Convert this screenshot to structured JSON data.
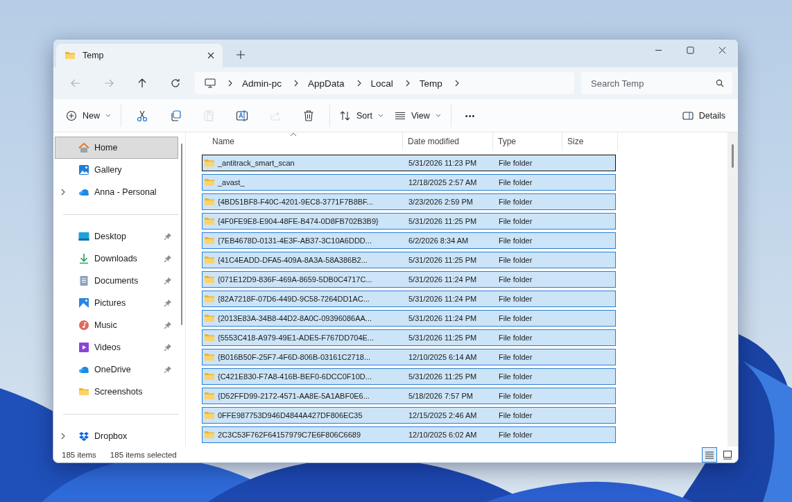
{
  "window": {
    "tabs": [
      {
        "title": "Temp",
        "selected": true
      }
    ]
  },
  "navigation": {
    "back": {
      "disabled": true
    },
    "forward": {
      "disabled": true
    },
    "up": {
      "disabled": false
    },
    "refresh": {
      "disabled": false
    }
  },
  "address_bar": {
    "segments": [
      "Admin-pc",
      "AppData",
      "Local",
      "Temp"
    ]
  },
  "search": {
    "placeholder": "Search Temp"
  },
  "toolbar": {
    "new": {
      "label": "New"
    },
    "actions": [
      {
        "disabled": false
      },
      {
        "disabled": false
      },
      {
        "disabled": true
      },
      {
        "disabled": false
      },
      {
        "disabled": true
      },
      {
        "disabled": false
      }
    ],
    "sort": {
      "label": "Sort"
    },
    "view": {
      "label": "View"
    },
    "more": {
      "label": "•••"
    },
    "details": {
      "label": "Details"
    }
  },
  "sidebar": {
    "sections": [
      {
        "items": [
          {
            "label": "Home",
            "selected": true,
            "expandable": false,
            "pinned": false
          },
          {
            "label": "Gallery",
            "selected": false,
            "expandable": false,
            "pinned": false
          },
          {
            "label": "Anna - Personal",
            "selected": false,
            "expandable": true,
            "pinned": false
          }
        ]
      },
      {
        "items": [
          {
            "label": "Desktop",
            "selected": false,
            "expandable": false,
            "pinned": true
          },
          {
            "label": "Downloads",
            "selected": false,
            "expandable": false,
            "pinned": true
          },
          {
            "label": "Documents",
            "selected": false,
            "expandable": false,
            "pinned": true
          },
          {
            "label": "Pictures",
            "selected": false,
            "expandable": false,
            "pinned": true
          },
          {
            "label": "Music",
            "selected": false,
            "expandable": false,
            "pinned": true
          },
          {
            "label": "Videos",
            "selected": false,
            "expandable": false,
            "pinned": true
          },
          {
            "label": "OneDrive",
            "selected": false,
            "expandable": false,
            "pinned": true
          },
          {
            "label": "Screenshots",
            "selected": false,
            "expandable": false,
            "pinned": false
          }
        ]
      },
      {
        "items": [
          {
            "label": "Dropbox",
            "selected": false,
            "expandable": true,
            "pinned": false
          }
        ]
      }
    ]
  },
  "table": {
    "columns": [
      "Name",
      "Date modified",
      "Type",
      "Size"
    ],
    "rows": [
      {
        "name": "_antitrack_smart_scan",
        "date": "5/31/2026 11:23 PM",
        "type": "File folder",
        "selected": true,
        "focused": true
      },
      {
        "name": "_avast_",
        "date": "12/18/2025 2:57 AM",
        "type": "File folder",
        "selected": true,
        "focused": false
      },
      {
        "name": "{4BD51BF8-F40C-4201-9EC8-3771F7B8BF...",
        "date": "3/23/2026 2:59 PM",
        "type": "File folder",
        "selected": true,
        "focused": false
      },
      {
        "name": "{4F0FE9E8-E904-48FE-B474-0D8FB702B3B9}",
        "date": "5/31/2026 11:25 PM",
        "type": "File folder",
        "selected": true,
        "focused": false
      },
      {
        "name": "{7EB4678D-0131-4E3F-AB37-3C10A6DDD...",
        "date": "6/2/2026 8:34 AM",
        "type": "File folder",
        "selected": true,
        "focused": false
      },
      {
        "name": "{41C4EADD-DFA5-409A-8A3A-58A386B2...",
        "date": "5/31/2026 11:25 PM",
        "type": "File folder",
        "selected": true,
        "focused": false
      },
      {
        "name": "{071E12D9-836F-469A-8659-5DB0C4717C...",
        "date": "5/31/2026 11:24 PM",
        "type": "File folder",
        "selected": true,
        "focused": false
      },
      {
        "name": "{82A7218F-07D6-449D-9C58-7264DD1AC...",
        "date": "5/31/2026 11:24 PM",
        "type": "File folder",
        "selected": true,
        "focused": false
      },
      {
        "name": "{2013E83A-34B8-44D2-8A0C-09396086AA...",
        "date": "5/31/2026 11:24 PM",
        "type": "File folder",
        "selected": true,
        "focused": false
      },
      {
        "name": "{5553C418-A979-49E1-ADE5-F767DD704E...",
        "date": "5/31/2026 11:25 PM",
        "type": "File folder",
        "selected": true,
        "focused": false
      },
      {
        "name": "{B016B50F-25F7-4F6D-806B-03161C2718...",
        "date": "12/10/2025 6:14 AM",
        "type": "File folder",
        "selected": true,
        "focused": false
      },
      {
        "name": "{C421E830-F7A8-416B-BEF0-6DCC0F10D...",
        "date": "5/31/2026 11:25 PM",
        "type": "File folder",
        "selected": true,
        "focused": false
      },
      {
        "name": "{D52FFD99-2172-4571-AA8E-5A1ABF0E6...",
        "date": "5/18/2026 7:57 PM",
        "type": "File folder",
        "selected": true,
        "focused": false
      },
      {
        "name": "0FFE987753D946D4844A427DF806EC35",
        "date": "12/15/2025 2:46 AM",
        "type": "File folder",
        "selected": true,
        "focused": false
      },
      {
        "name": "2C3C53F762F64157979C7E6F806C6689",
        "date": "12/10/2025 6:02 AM",
        "type": "File folder",
        "selected": true,
        "focused": false
      }
    ]
  },
  "status_bar": {
    "count": "185 items",
    "selection": "185 items selected",
    "views": [
      {
        "selected": true
      },
      {
        "selected": false
      }
    ]
  }
}
